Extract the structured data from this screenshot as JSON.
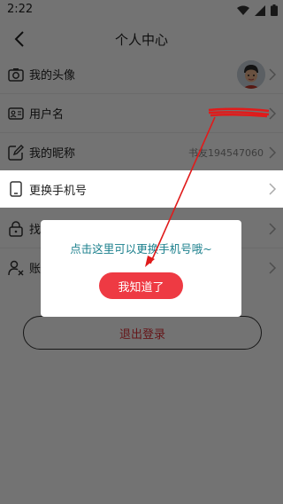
{
  "status_bar": {
    "time": "2:22"
  },
  "header": {
    "title": "个人中心"
  },
  "rows": [
    {
      "label": "我的头像",
      "value": ""
    },
    {
      "label": "用户名",
      "value": ""
    },
    {
      "label": "我的昵称",
      "value": "书友194547060"
    },
    {
      "label": "更换手机号",
      "value": ""
    },
    {
      "label": "找回密码",
      "value": ""
    },
    {
      "label": "账号注销",
      "value": ""
    }
  ],
  "logout": {
    "label": "退出登录"
  },
  "dialog": {
    "message": "点击这里可以更换手机号哦~",
    "button_label": "我知道了"
  },
  "colors": {
    "accent": "#ee3a43",
    "dialog_text": "#1a7f8c",
    "logout_text": "#e0333b"
  }
}
